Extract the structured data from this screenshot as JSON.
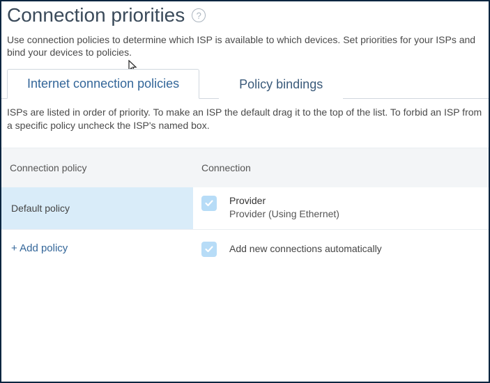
{
  "header": {
    "title": "Connection priorities",
    "intro": "Use connection policies to determine which ISP is available to which devices. Set priorities for your ISPs and bind your devices to policies."
  },
  "tabs": [
    {
      "label": "Internet connection policies",
      "active": true
    },
    {
      "label": "Policy bindings",
      "active": false
    }
  ],
  "tab_description": "ISPs are listed in order of priority. To make an ISP the default drag it to the top of the list. To forbid an ISP from a specific policy uncheck the ISP's named box.",
  "columns": {
    "policy_header": "Connection policy",
    "connection_header": "Connection"
  },
  "policies": [
    {
      "name": "Default policy",
      "selected": true
    }
  ],
  "connections": [
    {
      "name": "Provider",
      "detail": "Provider (Using Ethernet)",
      "checked": true
    }
  ],
  "actions": {
    "add_policy": "+ Add policy",
    "auto_add_label": "Add new connections automatically",
    "auto_add_checked": true
  }
}
